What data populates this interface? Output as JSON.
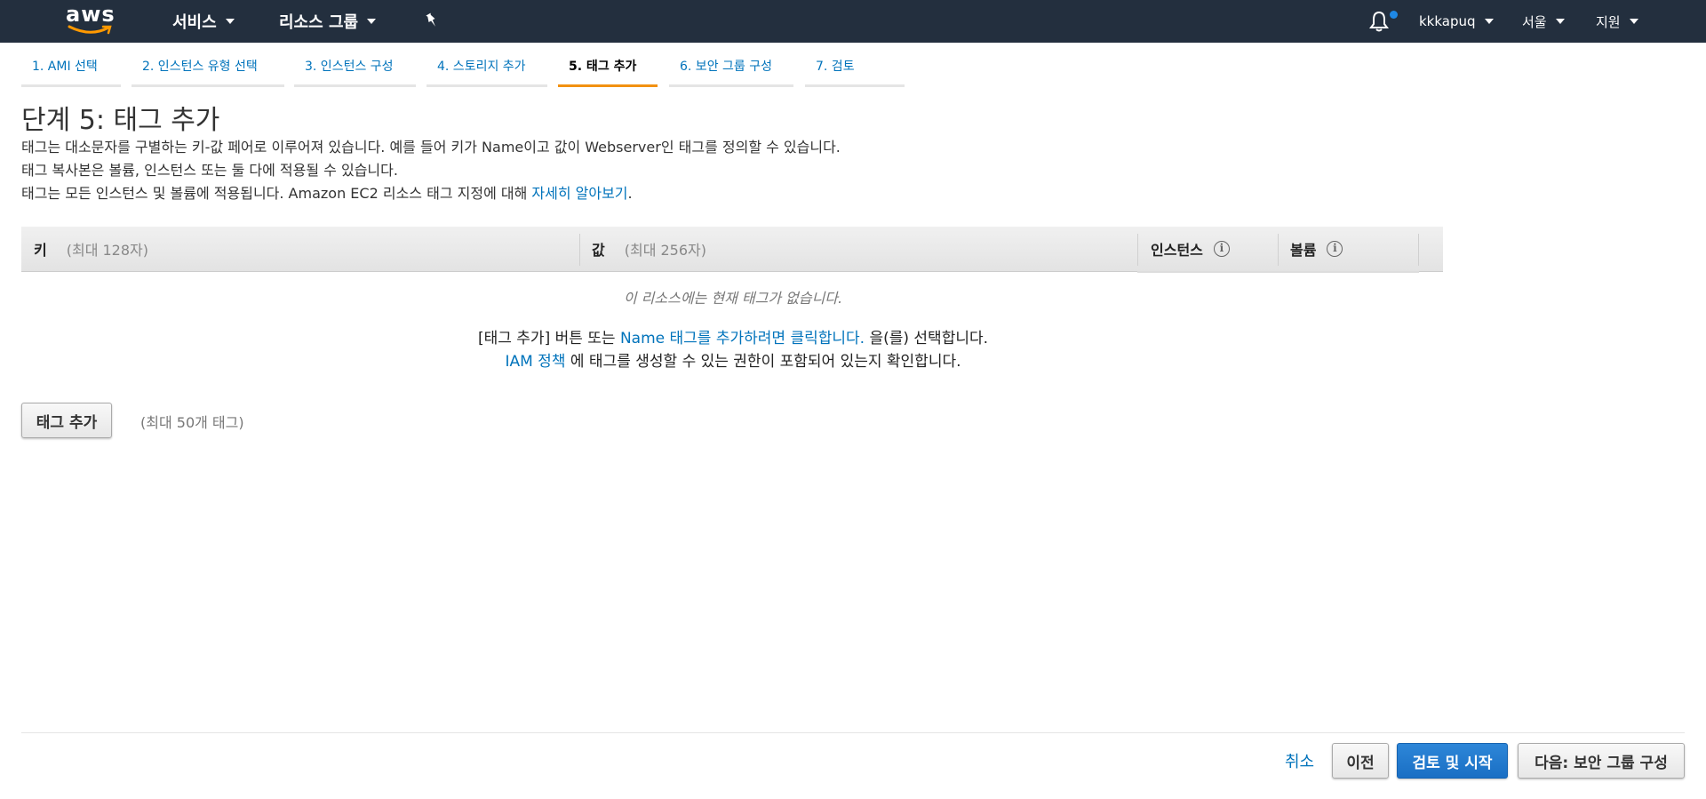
{
  "nav": {
    "logo": "aws",
    "services": "서비스",
    "resource_groups": "리소스 그룹",
    "user": "kkkapuq",
    "region": "서울",
    "support": "지원"
  },
  "tabs": [
    {
      "label": "1. AMI 선택"
    },
    {
      "label": "2. 인스턴스 유형 선택"
    },
    {
      "label": "3. 인스턴스 구성"
    },
    {
      "label": "4. 스토리지 추가"
    },
    {
      "label": "5. 태그 추가"
    },
    {
      "label": "6. 보안 그룹 구성"
    },
    {
      "label": "7. 검토"
    }
  ],
  "page": {
    "title": "단계 5: 태그 추가",
    "desc1": "태그는 대소문자를 구별하는 키-값 페어로 이루어져 있습니다. 예를 들어 키가 Name이고 값이 Webserver인 태그를 정의할 수 있습니다.",
    "desc2": "태그 복사본은 볼륨, 인스턴스 또는 둘 다에 적용될 수 있습니다.",
    "desc3_prefix": "태그는 모든 인스턴스 및 볼륨에 적용됩니다. Amazon EC2 리소스 태그 지정에 대해 ",
    "desc3_link": "자세히 알아보기",
    "desc3_suffix": "."
  },
  "table": {
    "key_header": "키",
    "key_hint": "(최대 128자)",
    "value_header": "값",
    "value_hint": "(최대 256자)",
    "instances_header": "인스턴스",
    "volumes_header": "볼륨",
    "empty_message": "이 리소스에는 현재 태그가 없습니다.",
    "line1_prefix": "[태그 추가] 버튼 또는 ",
    "line1_link": "Name 태그를 추가하려면 클릭합니다.",
    "line1_suffix": " 을(를) 선택합니다.",
    "line2_link": "IAM 정책",
    "line2_suffix": " 에 태그를 생성할 수 있는 권한이 포함되어 있는지 확인합니다."
  },
  "actions": {
    "add_tag": "태그 추가",
    "max_tags": "(최대 50개 태그)",
    "cancel": "취소",
    "previous": "이전",
    "review_launch": "검토 및 시작",
    "next": "다음: 보안 그룹 구성"
  }
}
